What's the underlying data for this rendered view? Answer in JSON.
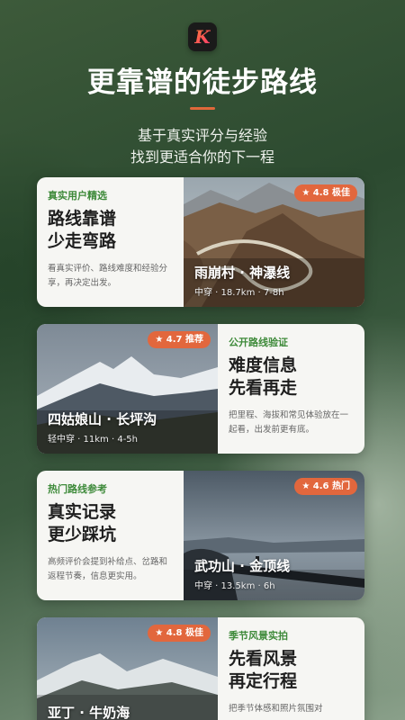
{
  "header": {
    "logo_letter": "K",
    "headline": "更靠谱的徒步路线",
    "subtitle_line1": "基于真实评分与经验",
    "subtitle_line2": "找到更适合你的下一程"
  },
  "colors": {
    "accent": "#e2673d",
    "tag_green": "#3e8a3a"
  },
  "cards": [
    {
      "tag": "真实用户精选",
      "title_line1": "路线靠谱",
      "title_line2": "少走弯路",
      "desc": "看真实评价、路线难度和经验分享，再决定出发。",
      "badge": "★ 4.8 极佳",
      "route": "雨崩村 · 神瀑线",
      "meta": "中穿 · 18.7km · 7-8h"
    },
    {
      "tag": "公开路线验证",
      "title_line1": "难度信息",
      "title_line2": "先看再走",
      "desc": "把里程、海拔和常见体验放在一起看，出发前更有底。",
      "badge": "★ 4.7 推荐",
      "route": "四姑娘山 · 长坪沟",
      "meta": "轻中穿 · 11km · 4-5h"
    },
    {
      "tag": "热门路线参考",
      "title_line1": "真实记录",
      "title_line2": "更少踩坑",
      "desc": "高频评价会提到补给点、岔路和返程节奏，信息更实用。",
      "badge": "★ 4.6 热门",
      "route": "武功山 · 金顶线",
      "meta": "中穿 · 13.5km · 6h"
    },
    {
      "tag": "季节风景实拍",
      "title_line1": "先看风景",
      "title_line2": "再定行程",
      "desc": "把季节体感和照片氛围对",
      "badge": "★ 4.8 极佳",
      "route": "亚丁 · 牛奶海",
      "meta": ""
    }
  ]
}
